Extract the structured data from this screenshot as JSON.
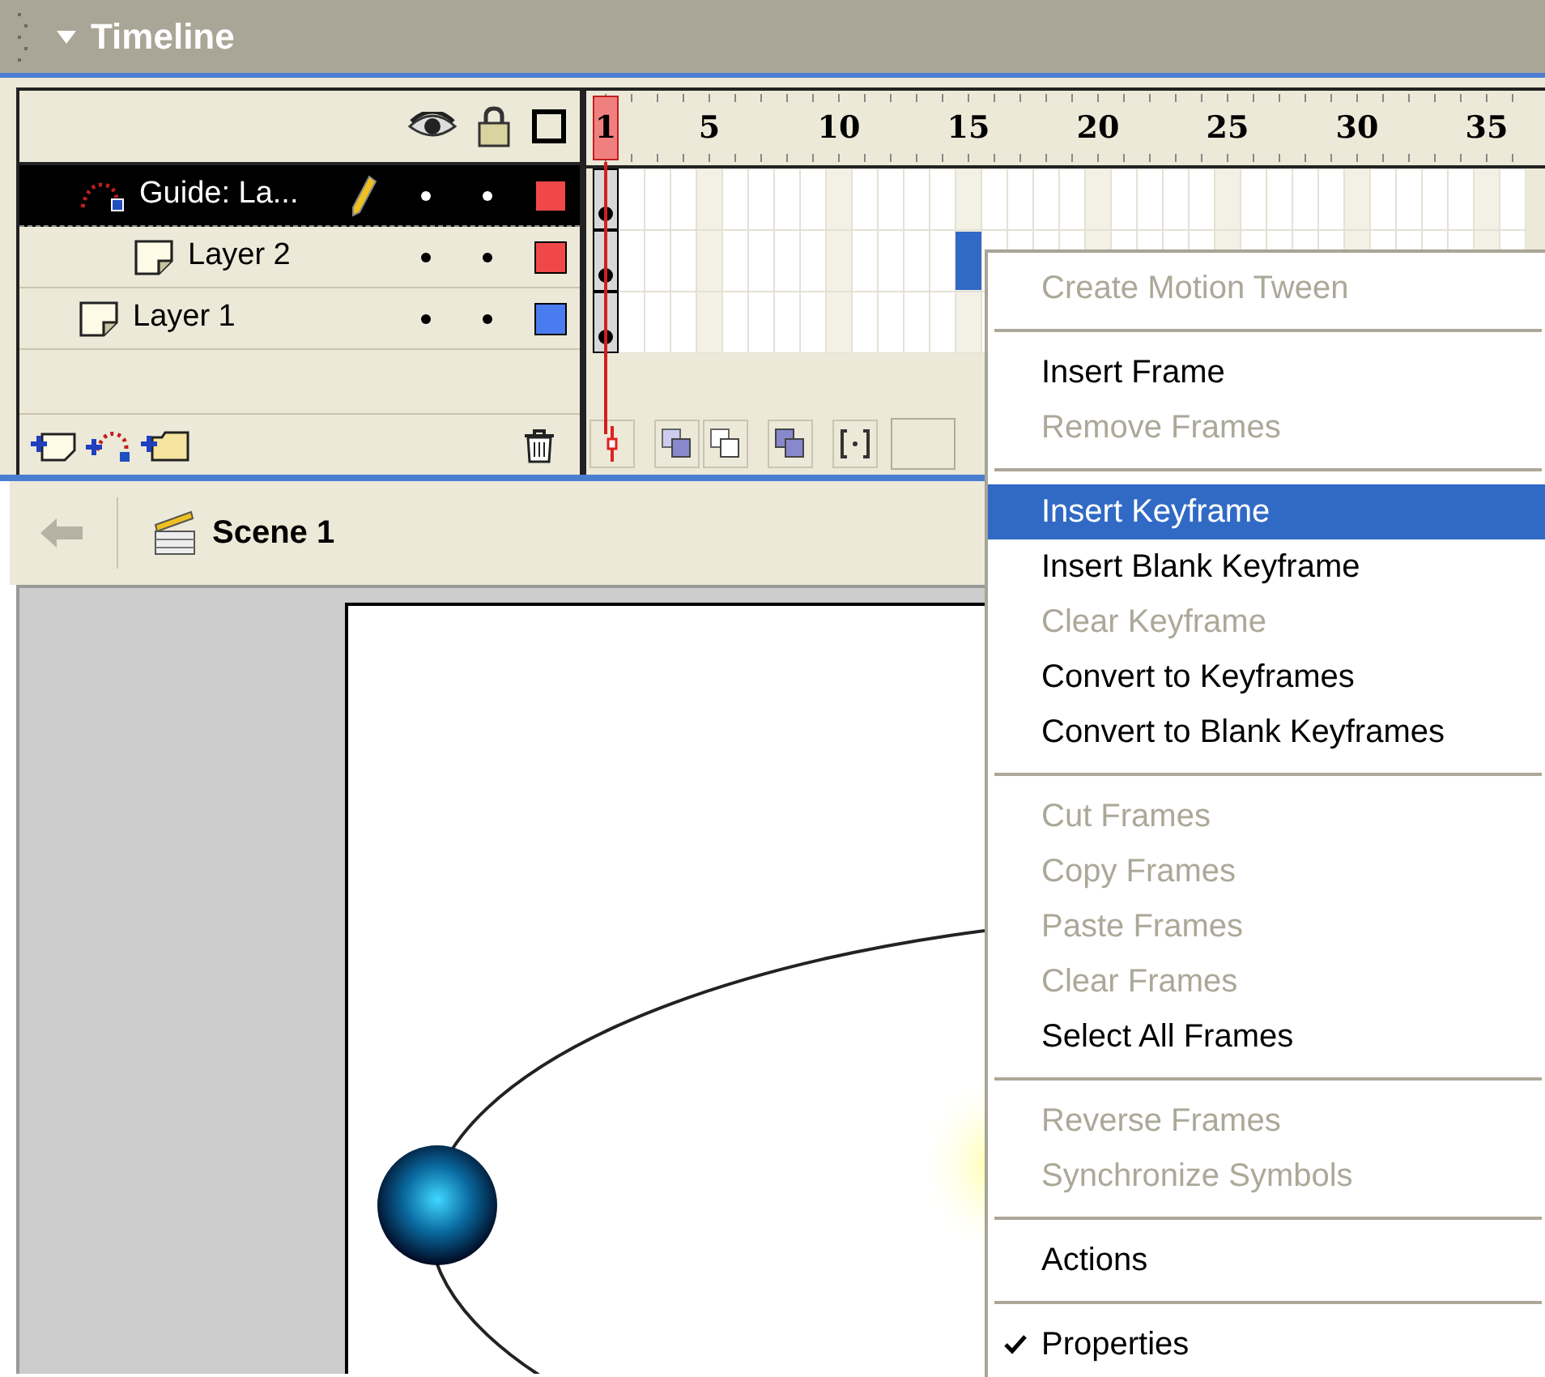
{
  "panel": {
    "title": "Timeline",
    "expanded": true
  },
  "frame_labels": [
    {
      "label": "1",
      "current": true
    },
    {
      "label": "5",
      "current": false
    },
    {
      "label": "10",
      "current": false
    },
    {
      "label": "15",
      "current": false
    },
    {
      "label": "20",
      "current": false
    },
    {
      "label": "25",
      "current": false
    },
    {
      "label": "30",
      "current": false
    },
    {
      "label": "35",
      "current": false
    }
  ],
  "layers": [
    {
      "name": "Guide: La...",
      "kind": "guide",
      "selected": true,
      "editing": true,
      "color": "#f04848",
      "frame_selected": false,
      "children": [
        {
          "name": "Layer 2",
          "kind": "layer",
          "selected": false,
          "editing": false,
          "color": "#f04848",
          "frame_selected": true
        }
      ]
    },
    {
      "name": "Layer 1",
      "kind": "layer",
      "selected": false,
      "editing": false,
      "color": "#4a7cf0",
      "frame_selected": false
    }
  ],
  "scene": {
    "name": "Scene 1"
  },
  "context_menu": [
    {
      "kind": "item",
      "label": "Create Motion Tween",
      "disabled": true,
      "selected": false,
      "checked": false
    },
    {
      "kind": "separator"
    },
    {
      "kind": "item",
      "label": "Insert Frame",
      "disabled": false,
      "selected": false,
      "checked": false
    },
    {
      "kind": "item",
      "label": "Remove Frames",
      "disabled": true,
      "selected": false,
      "checked": false
    },
    {
      "kind": "separator"
    },
    {
      "kind": "item",
      "label": "Insert Keyframe",
      "disabled": false,
      "selected": true,
      "checked": false
    },
    {
      "kind": "item",
      "label": "Insert Blank Keyframe",
      "disabled": false,
      "selected": false,
      "checked": false
    },
    {
      "kind": "item",
      "label": "Clear Keyframe",
      "disabled": true,
      "selected": false,
      "checked": false
    },
    {
      "kind": "item",
      "label": "Convert to Keyframes",
      "disabled": false,
      "selected": false,
      "checked": false
    },
    {
      "kind": "item",
      "label": "Convert to Blank Keyframes",
      "disabled": false,
      "selected": false,
      "checked": false
    },
    {
      "kind": "separator"
    },
    {
      "kind": "item",
      "label": "Cut Frames",
      "disabled": true,
      "selected": false,
      "checked": false
    },
    {
      "kind": "item",
      "label": "Copy Frames",
      "disabled": true,
      "selected": false,
      "checked": false
    },
    {
      "kind": "item",
      "label": "Paste Frames",
      "disabled": true,
      "selected": false,
      "checked": false
    },
    {
      "kind": "item",
      "label": "Clear Frames",
      "disabled": true,
      "selected": false,
      "checked": false
    },
    {
      "kind": "item",
      "label": "Select All Frames",
      "disabled": false,
      "selected": false,
      "checked": false
    },
    {
      "kind": "separator"
    },
    {
      "kind": "item",
      "label": "Reverse Frames",
      "disabled": true,
      "selected": false,
      "checked": false
    },
    {
      "kind": "item",
      "label": "Synchronize Symbols",
      "disabled": true,
      "selected": false,
      "checked": false
    },
    {
      "kind": "separator"
    },
    {
      "kind": "item",
      "label": "Actions",
      "disabled": false,
      "selected": false,
      "checked": false
    },
    {
      "kind": "separator"
    },
    {
      "kind": "item",
      "label": "Properties",
      "disabled": false,
      "selected": false,
      "checked": true
    }
  ]
}
